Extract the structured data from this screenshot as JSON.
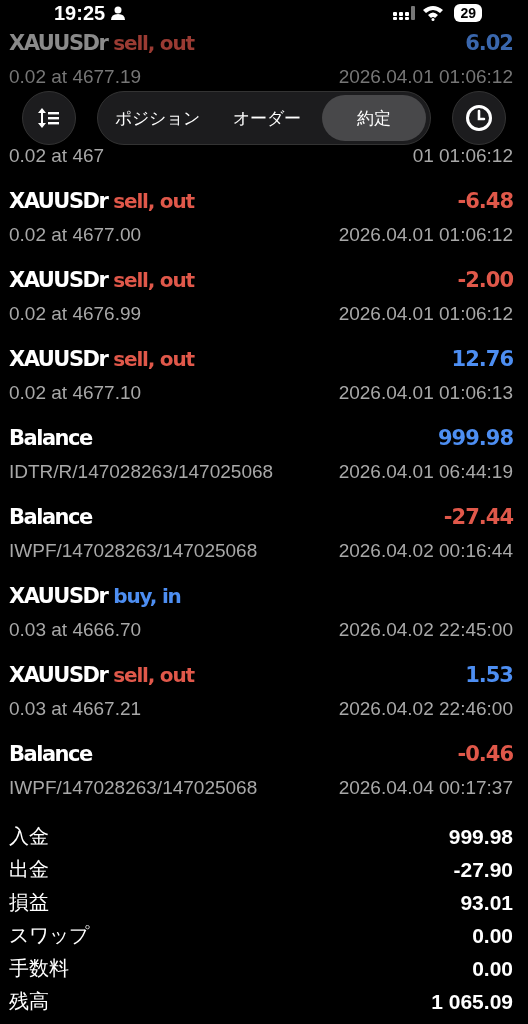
{
  "status_bar": {
    "time": "19:25",
    "battery": "29"
  },
  "toolbar": {
    "tabs": [
      {
        "label": "ポジション",
        "selected": false
      },
      {
        "label": "オーダー",
        "selected": false
      },
      {
        "label": "約定",
        "selected": true
      }
    ]
  },
  "deals": [
    {
      "symbol": "XAUUSDr",
      "action": "sell, out",
      "color": "#9a3b33",
      "amount": "6.02",
      "loss": false,
      "detail": "0.02 at 4677.19",
      "time": "2026.04.01 01:06:12",
      "dimmed": true
    },
    {
      "detail": "0.02 at 467",
      "time": "01 01:06:12",
      "dimmed": false
    },
    {
      "symbol": "XAUUSDr",
      "action": "sell, out",
      "color": "#e0584a",
      "amount": "-6.48",
      "loss": true,
      "detail": "0.02 at 4677.00",
      "time": "2026.04.01 01:06:12",
      "dimmed": false
    },
    {
      "symbol": "XAUUSDr",
      "action": "sell, out",
      "color": "#e0584a",
      "amount": "-2.00",
      "loss": true,
      "detail": "0.02 at 4676.99",
      "time": "2026.04.01 01:06:12",
      "dimmed": false
    },
    {
      "symbol": "XAUUSDr",
      "action": "sell, out",
      "color": "#e0584a",
      "amount": "12.76",
      "loss": false,
      "detail": "0.02 at 4677.10",
      "time": "2026.04.01 01:06:13",
      "dimmed": false
    },
    {
      "symbol": "Balance",
      "amount": "999.98",
      "loss": false,
      "detail": "IDTR/R/147028263/147025068",
      "time": "2026.04.01 06:44:19",
      "dimmed": false
    },
    {
      "symbol": "Balance",
      "amount": "-27.44",
      "loss": true,
      "detail": "IWPF/147028263/147025068",
      "time": "2026.04.02 00:16:44",
      "dimmed": false
    },
    {
      "symbol": "XAUUSDr",
      "action": "buy, in",
      "color": "#4d8ef2",
      "detail": "0.03 at 4666.70",
      "time": "2026.04.02 22:45:00",
      "dimmed": false
    },
    {
      "symbol": "XAUUSDr",
      "action": "sell, out",
      "color": "#e0584a",
      "amount": "1.53",
      "loss": false,
      "detail": "0.03 at 4667.21",
      "time": "2026.04.02 22:46:00",
      "dimmed": false
    },
    {
      "symbol": "Balance",
      "amount": "-0.46",
      "loss": true,
      "detail": "IWPF/147028263/147025068",
      "time": "2026.04.04 00:17:37",
      "dimmed": false
    }
  ],
  "summary": [
    {
      "label": "入金",
      "value": "999.98"
    },
    {
      "label": "出金",
      "value": "-27.90"
    },
    {
      "label": "損益",
      "value": "93.01"
    },
    {
      "label": "スワップ",
      "value": "0.00"
    },
    {
      "label": "手数料",
      "value": "0.00"
    },
    {
      "label": "残高",
      "value": "1 065.09"
    }
  ]
}
